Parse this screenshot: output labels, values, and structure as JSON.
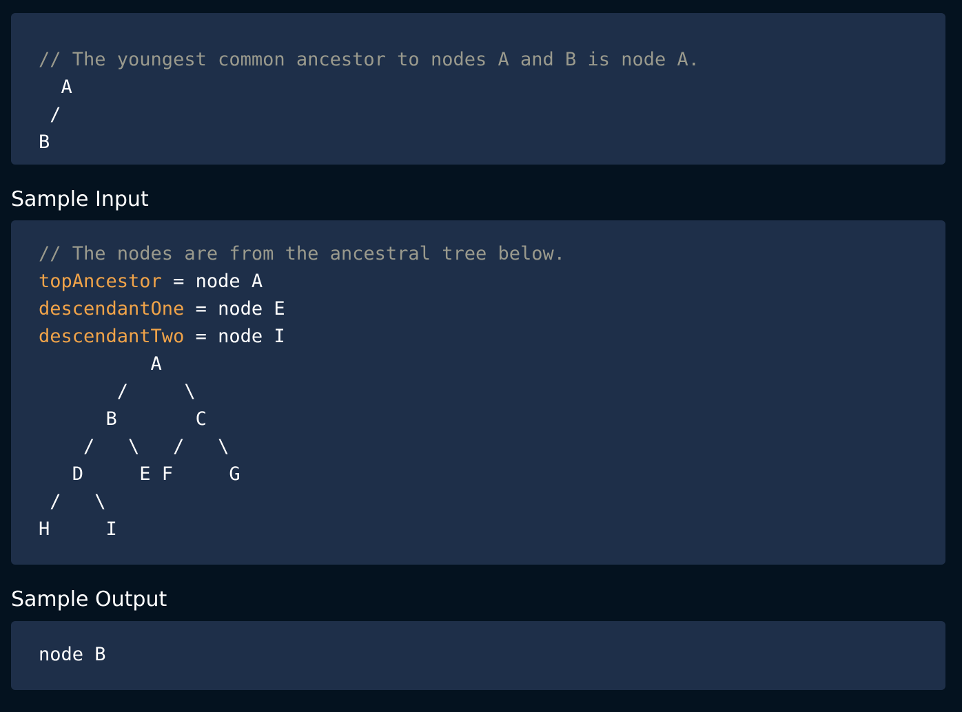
{
  "explanation": {
    "comment": "// The youngest common ancestor to nodes A and B is node A.",
    "tree": "  A\n /\nB"
  },
  "sample_input": {
    "heading": "Sample Input",
    "comment": "// The nodes are from the ancestral tree below.",
    "assignments": [
      {
        "name": "topAncestor",
        "operator": " = ",
        "value": "node A"
      },
      {
        "name": "descendantOne",
        "operator": " = ",
        "value": "node E"
      },
      {
        "name": "descendantTwo",
        "operator": " = ",
        "value": "node I"
      }
    ],
    "tree": "          A\n       /     \\\n      B       C\n    /   \\   /   \\\n   D     E F     G\n /   \\\nH     I"
  },
  "sample_output": {
    "heading": "Sample Output",
    "value": "node B"
  },
  "colors": {
    "page_background": "#04121f",
    "block_background": "#1e2f49",
    "comment": "#9a9a8d",
    "variable": "#f0a349",
    "text": "#ffffff"
  }
}
